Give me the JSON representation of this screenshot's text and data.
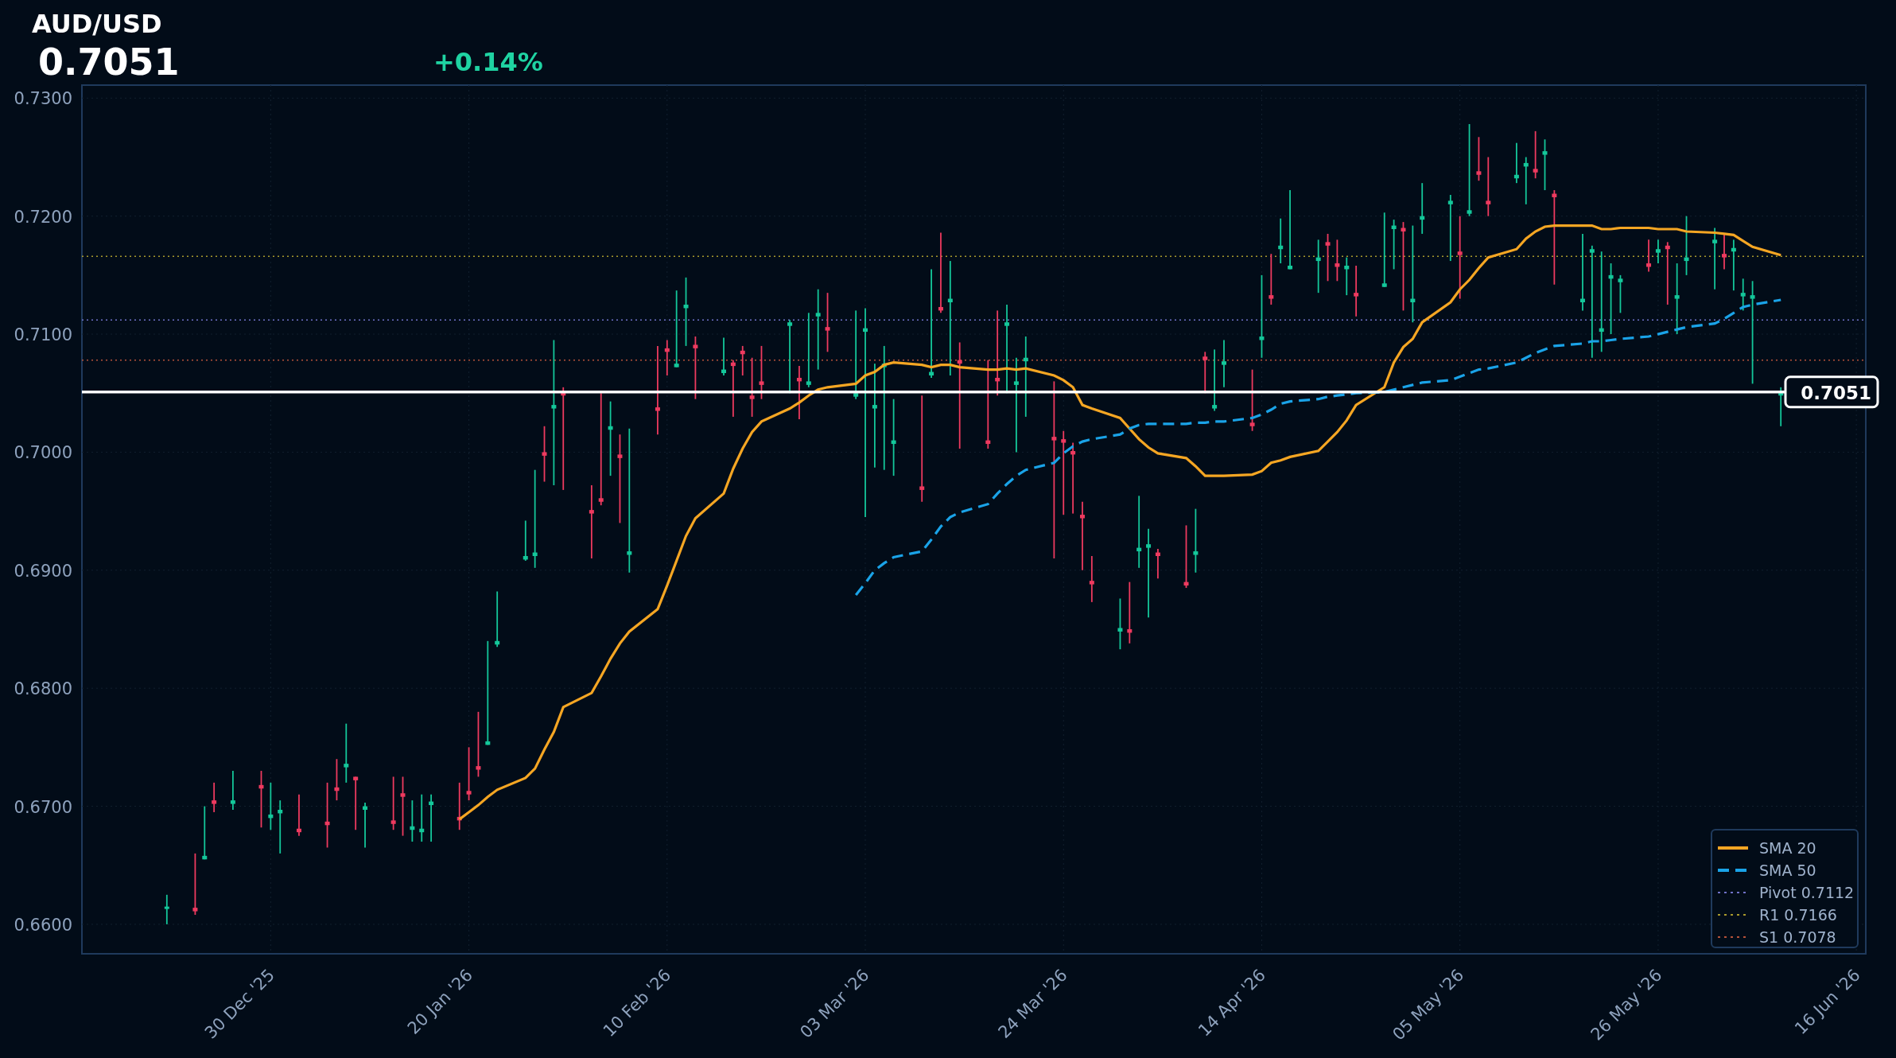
{
  "header": {
    "symbol": "AUD/USD",
    "price": "0.7051",
    "change": "+0.14%"
  },
  "chart": {
    "price_tag": "0.7051",
    "chart_data": {
      "type": "candlestick",
      "legend": "lower right",
      "x": [
        "2025-12-19",
        "2025-12-22",
        "2025-12-23",
        "2025-12-24",
        "2025-12-26",
        "2025-12-29",
        "2025-12-30",
        "2025-12-31",
        "2026-01-02",
        "2026-01-05",
        "2026-01-06",
        "2026-01-07",
        "2026-01-08",
        "2026-01-09",
        "2026-01-12",
        "2026-01-13",
        "2026-01-14",
        "2026-01-15",
        "2026-01-16",
        "2026-01-19",
        "2026-01-20",
        "2026-01-21",
        "2026-01-22",
        "2026-01-23",
        "2026-01-26",
        "2026-01-27",
        "2026-01-28",
        "2026-01-29",
        "2026-01-30",
        "2026-02-02",
        "2026-02-03",
        "2026-02-04",
        "2026-02-05",
        "2026-02-06",
        "2026-02-09",
        "2026-02-10",
        "2026-02-11",
        "2026-02-12",
        "2026-02-13",
        "2026-02-16",
        "2026-02-17",
        "2026-02-18",
        "2026-02-19",
        "2026-02-20",
        "2026-02-23",
        "2026-02-24",
        "2026-02-25",
        "2026-02-26",
        "2026-02-27",
        "2026-03-02",
        "2026-03-03",
        "2026-03-04",
        "2026-03-05",
        "2026-03-06",
        "2026-03-09",
        "2026-03-10",
        "2026-03-11",
        "2026-03-12",
        "2026-03-13",
        "2026-03-16",
        "2026-03-17",
        "2026-03-18",
        "2026-03-19",
        "2026-03-20",
        "2026-03-23",
        "2026-03-24",
        "2026-03-25",
        "2026-03-26",
        "2026-03-27",
        "2026-03-30",
        "2026-03-31",
        "2026-04-01",
        "2026-04-02",
        "2026-04-03",
        "2026-04-06",
        "2026-04-07",
        "2026-04-08",
        "2026-04-09",
        "2026-04-10",
        "2026-04-13",
        "2026-04-14",
        "2026-04-15",
        "2026-04-16",
        "2026-04-17",
        "2026-04-20",
        "2026-04-21",
        "2026-04-22",
        "2026-04-23",
        "2026-04-24",
        "2026-04-27",
        "2026-04-28",
        "2026-04-29",
        "2026-04-30",
        "2026-05-01",
        "2026-05-04",
        "2026-05-05",
        "2026-05-06",
        "2026-05-07",
        "2026-05-08",
        "2026-05-11",
        "2026-05-12",
        "2026-05-13",
        "2026-05-14",
        "2026-05-15",
        "2026-05-18",
        "2026-05-19",
        "2026-05-20",
        "2026-05-21",
        "2026-05-22",
        "2026-05-25",
        "2026-05-26",
        "2026-05-27",
        "2026-05-28",
        "2026-05-29",
        "2026-06-01",
        "2026-06-02",
        "2026-06-03",
        "2026-06-04",
        "2026-06-05",
        "2026-06-08"
      ],
      "ohlc": [
        [
          0.6613,
          0.6625,
          0.66,
          0.6615
        ],
        [
          0.6614,
          0.666,
          0.6608,
          0.6611
        ],
        [
          0.6655,
          0.67,
          0.6655,
          0.6658
        ],
        [
          0.6705,
          0.672,
          0.6695,
          0.6702
        ],
        [
          0.6702,
          0.673,
          0.6697,
          0.6705
        ],
        [
          0.6718,
          0.673,
          0.6682,
          0.6715
        ],
        [
          0.669,
          0.672,
          0.668,
          0.6693
        ],
        [
          0.6694,
          0.6705,
          0.666,
          0.6697
        ],
        [
          0.6681,
          0.671,
          0.6675,
          0.6678
        ],
        [
          0.6687,
          0.672,
          0.6665,
          0.6684
        ],
        [
          0.6716,
          0.674,
          0.6705,
          0.6713
        ],
        [
          0.6733,
          0.677,
          0.672,
          0.6736
        ],
        [
          0.6725,
          0.6725,
          0.668,
          0.6722
        ],
        [
          0.6697,
          0.6703,
          0.6665,
          0.67
        ],
        [
          0.6688,
          0.6725,
          0.668,
          0.6685
        ],
        [
          0.6711,
          0.6725,
          0.6675,
          0.6708
        ],
        [
          0.668,
          0.6705,
          0.667,
          0.6683
        ],
        [
          0.6678,
          0.671,
          0.667,
          0.6681
        ],
        [
          0.6701,
          0.671,
          0.667,
          0.6704
        ],
        [
          0.6691,
          0.672,
          0.668,
          0.6688
        ],
        [
          0.6713,
          0.675,
          0.6705,
          0.671
        ],
        [
          0.6734,
          0.678,
          0.6725,
          0.6731
        ],
        [
          0.6752,
          0.684,
          0.6752,
          0.6755
        ],
        [
          0.6837,
          0.6882,
          0.6835,
          0.684
        ],
        [
          0.6909,
          0.6942,
          0.6908,
          0.6912
        ],
        [
          0.6912,
          0.6985,
          0.6902,
          0.6915
        ],
        [
          0.7,
          0.7022,
          0.6975,
          0.6997
        ],
        [
          0.7037,
          0.7095,
          0.6972,
          0.704
        ],
        [
          0.7051,
          0.7055,
          0.6968,
          0.7048
        ],
        [
          0.6951,
          0.6972,
          0.691,
          0.6948
        ],
        [
          0.6961,
          0.705,
          0.6955,
          0.6958
        ],
        [
          0.7019,
          0.7043,
          0.698,
          0.7022
        ],
        [
          0.6998,
          0.7015,
          0.694,
          0.6995
        ],
        [
          0.6913,
          0.702,
          0.6898,
          0.6916
        ],
        [
          0.7038,
          0.709,
          0.7015,
          0.7035
        ],
        [
          0.7088,
          0.7095,
          0.7065,
          0.7085
        ],
        [
          0.7072,
          0.7137,
          0.7072,
          0.7075
        ],
        [
          0.7122,
          0.7148,
          0.709,
          0.7125
        ],
        [
          0.7091,
          0.7098,
          0.7045,
          0.7088
        ],
        [
          0.7067,
          0.7097,
          0.7065,
          0.707
        ],
        [
          0.7076,
          0.7078,
          0.703,
          0.7073
        ],
        [
          0.7086,
          0.709,
          0.7065,
          0.7083
        ],
        [
          0.7048,
          0.708,
          0.703,
          0.7045
        ],
        [
          0.706,
          0.709,
          0.7045,
          0.7057
        ],
        [
          0.7107,
          0.7112,
          0.705,
          0.711
        ],
        [
          0.7063,
          0.7073,
          0.7028,
          0.706
        ],
        [
          0.7057,
          0.7118,
          0.7055,
          0.706
        ],
        [
          0.7115,
          0.7138,
          0.707,
          0.7118
        ],
        [
          0.7106,
          0.7135,
          0.7085,
          0.7103
        ],
        [
          0.7047,
          0.712,
          0.7045,
          0.705
        ],
        [
          0.7102,
          0.7122,
          0.6945,
          0.7105
        ],
        [
          0.7037,
          0.7075,
          0.6987,
          0.704
        ],
        [
          0.7072,
          0.709,
          0.6985,
          0.7075
        ],
        [
          0.7007,
          0.7045,
          0.698,
          0.701
        ],
        [
          0.6971,
          0.7048,
          0.6958,
          0.6968
        ],
        [
          0.7065,
          0.7155,
          0.7063,
          0.7068
        ],
        [
          0.7123,
          0.7186,
          0.7118,
          0.712
        ],
        [
          0.7127,
          0.7162,
          0.7065,
          0.713
        ],
        [
          0.7078,
          0.7093,
          0.7003,
          0.7075
        ],
        [
          0.701,
          0.7078,
          0.7003,
          0.7007
        ],
        [
          0.7063,
          0.712,
          0.7048,
          0.706
        ],
        [
          0.7107,
          0.7125,
          0.705,
          0.711
        ],
        [
          0.7057,
          0.708,
          0.7,
          0.706
        ],
        [
          0.7077,
          0.7098,
          0.703,
          0.708
        ],
        [
          0.7013,
          0.706,
          0.691,
          0.701
        ],
        [
          0.7011,
          0.7018,
          0.6947,
          0.7008
        ],
        [
          0.7001,
          0.7008,
          0.6948,
          0.6998
        ],
        [
          0.6947,
          0.6958,
          0.69,
          0.6944
        ],
        [
          0.6891,
          0.6912,
          0.6873,
          0.6888
        ],
        [
          0.6848,
          0.6876,
          0.6833,
          0.6851
        ],
        [
          0.685,
          0.689,
          0.6838,
          0.6847
        ],
        [
          0.6916,
          0.6963,
          0.6902,
          0.6919
        ],
        [
          0.6919,
          0.6935,
          0.686,
          0.6922
        ],
        [
          0.6915,
          0.6918,
          0.6893,
          0.6912
        ],
        [
          0.689,
          0.6938,
          0.6885,
          0.6887
        ],
        [
          0.6913,
          0.6952,
          0.6898,
          0.6916
        ],
        [
          0.7081,
          0.7085,
          0.705,
          0.7078
        ],
        [
          0.7037,
          0.7087,
          0.7035,
          0.704
        ],
        [
          0.7074,
          0.7095,
          0.7055,
          0.7077
        ],
        [
          0.7025,
          0.707,
          0.7018,
          0.7022
        ],
        [
          0.7095,
          0.715,
          0.708,
          0.7098
        ],
        [
          0.7133,
          0.7168,
          0.7125,
          0.713
        ],
        [
          0.7172,
          0.7198,
          0.716,
          0.7175
        ],
        [
          0.7155,
          0.7222,
          0.7155,
          0.7158
        ],
        [
          0.7162,
          0.718,
          0.7135,
          0.7165
        ],
        [
          0.7178,
          0.7185,
          0.7145,
          0.7175
        ],
        [
          0.716,
          0.718,
          0.7145,
          0.7157
        ],
        [
          0.7155,
          0.7165,
          0.7133,
          0.7158
        ],
        [
          0.7135,
          0.7158,
          0.7115,
          0.7132
        ],
        [
          0.714,
          0.7203,
          0.714,
          0.7143
        ],
        [
          0.7189,
          0.7197,
          0.7155,
          0.7192
        ],
        [
          0.719,
          0.7195,
          0.712,
          0.7187
        ],
        [
          0.7127,
          0.7192,
          0.711,
          0.713
        ],
        [
          0.7197,
          0.7228,
          0.7185,
          0.72
        ],
        [
          0.721,
          0.7218,
          0.7162,
          0.7213
        ],
        [
          0.717,
          0.72,
          0.713,
          0.7167
        ],
        [
          0.7202,
          0.7278,
          0.72,
          0.7205
        ],
        [
          0.7238,
          0.7267,
          0.723,
          0.7235
        ],
        [
          0.7213,
          0.725,
          0.72,
          0.721
        ],
        [
          0.7232,
          0.7262,
          0.7228,
          0.7235
        ],
        [
          0.7242,
          0.725,
          0.721,
          0.7245
        ],
        [
          0.724,
          0.7272,
          0.7232,
          0.7237
        ],
        [
          0.7252,
          0.7265,
          0.7222,
          0.7255
        ],
        [
          0.7219,
          0.7222,
          0.7142,
          0.7216
        ],
        [
          0.7127,
          0.7185,
          0.712,
          0.713
        ],
        [
          0.7169,
          0.7175,
          0.708,
          0.7172
        ],
        [
          0.7102,
          0.717,
          0.7085,
          0.7105
        ],
        [
          0.7147,
          0.716,
          0.71,
          0.715
        ],
        [
          0.7144,
          0.715,
          0.7118,
          0.7147
        ],
        [
          0.716,
          0.718,
          0.7153,
          0.7157
        ],
        [
          0.7169,
          0.718,
          0.716,
          0.7172
        ],
        [
          0.7175,
          0.7178,
          0.7125,
          0.7172
        ],
        [
          0.713,
          0.716,
          0.71,
          0.7133
        ],
        [
          0.7162,
          0.72,
          0.715,
          0.7165
        ],
        [
          0.7177,
          0.719,
          0.7138,
          0.718
        ],
        [
          0.7168,
          0.7185,
          0.7155,
          0.7165
        ],
        [
          0.717,
          0.718,
          0.7137,
          0.7173
        ],
        [
          0.7132,
          0.7147,
          0.712,
          0.7135
        ],
        [
          0.713,
          0.7145,
          0.7058,
          0.7133
        ],
        [
          0.7048,
          0.7055,
          0.7022,
          0.7051
        ]
      ],
      "series": [
        {
          "name": "SMA 20",
          "type": "line",
          "line_style": "solid",
          "color": "#f5a623",
          "values": [
            null,
            null,
            null,
            null,
            null,
            null,
            null,
            null,
            null,
            null,
            null,
            null,
            null,
            null,
            null,
            null,
            null,
            null,
            null,
            0.6689,
            0.6695,
            0.6701,
            0.6708,
            0.6714,
            0.6724,
            0.6732,
            0.6748,
            0.6763,
            0.6784,
            0.6796,
            0.681,
            0.6825,
            0.6838,
            0.6848,
            0.6867,
            0.6887,
            0.6908,
            0.6929,
            0.6944,
            0.6965,
            0.6986,
            0.7003,
            0.7017,
            0.7026,
            0.7037,
            0.7042,
            0.7048,
            0.7053,
            0.7055,
            0.7058,
            0.7065,
            0.7068,
            0.7074,
            0.7076,
            0.7074,
            0.7072,
            0.7074,
            0.7074,
            0.7072,
            0.707,
            0.707,
            0.7071,
            0.707,
            0.7071,
            0.7065,
            0.7061,
            0.7055,
            0.704,
            0.7037,
            0.7029,
            0.702,
            0.7011,
            0.7004,
            0.6999,
            0.6995,
            0.6988,
            0.698,
            0.698,
            0.698,
            0.6981,
            0.6984,
            0.6991,
            0.6993,
            0.6996,
            0.7001,
            0.7009,
            0.7017,
            0.7027,
            0.704,
            0.7055,
            0.7076,
            0.7089,
            0.7096,
            0.711,
            0.7127,
            0.7138,
            0.7146,
            0.7156,
            0.7165,
            0.7172,
            0.7181,
            0.7187,
            0.7191,
            0.7192,
            0.7192,
            0.7192,
            0.7189,
            0.7189,
            0.719,
            0.719,
            0.7189,
            0.7189,
            0.7189,
            0.7187,
            0.7186,
            0.7185,
            0.7184,
            0.7179,
            0.7174,
            0.7167
          ]
        },
        {
          "name": "SMA 50",
          "type": "line",
          "line_style": "dashed",
          "color": "#1aa3e8",
          "values": [
            null,
            null,
            null,
            null,
            null,
            null,
            null,
            null,
            null,
            null,
            null,
            null,
            null,
            null,
            null,
            null,
            null,
            null,
            null,
            null,
            null,
            null,
            null,
            null,
            null,
            null,
            null,
            null,
            null,
            null,
            null,
            null,
            null,
            null,
            null,
            null,
            null,
            null,
            null,
            null,
            null,
            null,
            null,
            null,
            null,
            null,
            null,
            null,
            null,
            0.6879,
            0.6889,
            0.69,
            0.6906,
            0.6911,
            0.6916,
            0.6926,
            0.6937,
            0.6945,
            0.6949,
            0.6956,
            0.6965,
            0.6973,
            0.698,
            0.6985,
            0.6991,
            0.6999,
            0.7005,
            0.7009,
            0.7011,
            0.7015,
            0.702,
            0.7023,
            0.7024,
            0.7024,
            0.7024,
            0.7025,
            0.7025,
            0.7026,
            0.7026,
            0.7029,
            0.7032,
            0.7036,
            0.7041,
            0.7043,
            0.7045,
            0.7047,
            0.7048,
            0.7049,
            0.705,
            0.7051,
            0.7053,
            0.7055,
            0.7057,
            0.7059,
            0.7061,
            0.7064,
            0.7067,
            0.707,
            0.7071,
            0.7076,
            0.708,
            0.7084,
            0.7087,
            0.709,
            0.7092,
            0.7094,
            0.7094,
            0.7095,
            0.7096,
            0.7098,
            0.71,
            0.7102,
            0.7104,
            0.7106,
            0.7109,
            0.7113,
            0.7118,
            0.7123,
            0.7125,
            0.7129
          ]
        }
      ],
      "xlim": [
        "2025-12-10",
        "2026-06-17"
      ],
      "ylim": [
        0.6575,
        0.7311
      ],
      "xticks": [
        {
          "value": "2025-12-30",
          "label": "30 Dec '25"
        },
        {
          "value": "2026-01-20",
          "label": "20 Jan '26"
        },
        {
          "value": "2026-02-10",
          "label": "10 Feb '26"
        },
        {
          "value": "2026-03-03",
          "label": "03 Mar '26"
        },
        {
          "value": "2026-03-24",
          "label": "24 Mar '26"
        },
        {
          "value": "2026-04-14",
          "label": "14 Apr '26"
        },
        {
          "value": "2026-05-05",
          "label": "05 May '26"
        },
        {
          "value": "2026-05-26",
          "label": "26 May '26"
        },
        {
          "value": "2026-06-16",
          "label": "16 Jun '26"
        }
      ],
      "yticks": [
        {
          "value": 0.66,
          "label": "0.6600"
        },
        {
          "value": 0.67,
          "label": "0.6700"
        },
        {
          "value": 0.68,
          "label": "0.6800"
        },
        {
          "value": 0.69,
          "label": "0.6900"
        },
        {
          "value": 0.7,
          "label": "0.7000"
        },
        {
          "value": 0.71,
          "label": "0.7100"
        },
        {
          "value": 0.72,
          "label": "0.7200"
        },
        {
          "value": 0.73,
          "label": "0.7300"
        }
      ],
      "grid": true,
      "ref_lines": [
        {
          "axis": "y",
          "value": 0.7112,
          "label": "Pivot 0.7112",
          "color": "#6f72c8"
        },
        {
          "axis": "y",
          "value": 0.7166,
          "label": "R1 0.7166",
          "color": "#a89a2c"
        },
        {
          "axis": "y",
          "value": 0.7078,
          "label": "S1 0.7078",
          "color": "#b5523a"
        },
        {
          "axis": "y",
          "value": 0.7051,
          "color": "#ffffff"
        }
      ]
    }
  }
}
